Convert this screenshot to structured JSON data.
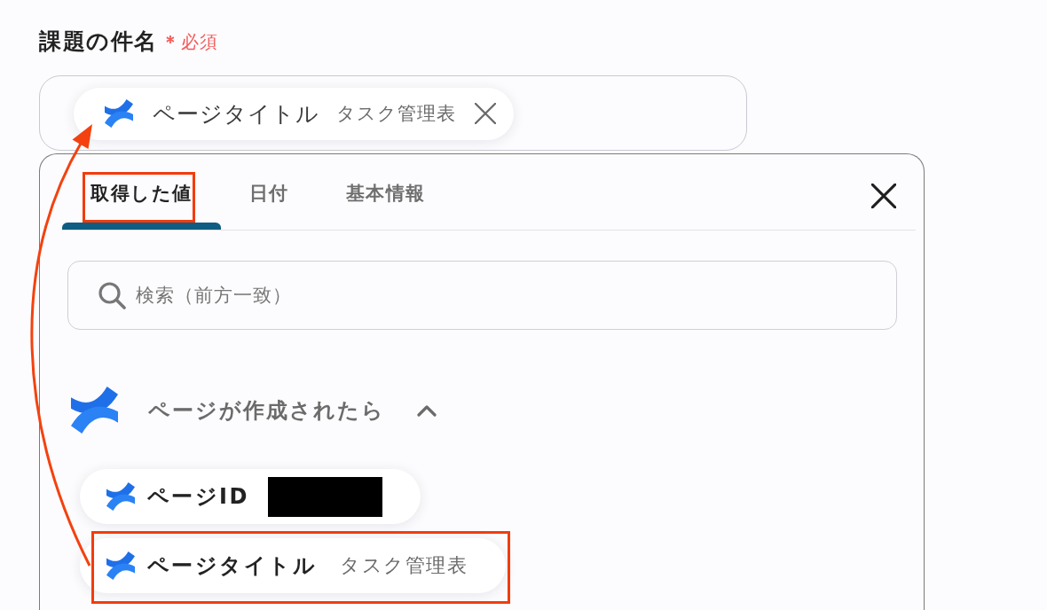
{
  "field": {
    "label": "課題の件名",
    "required_mark": "＊",
    "required_text": "必須",
    "token": {
      "label": "ページタイトル",
      "value": "タスク管理表"
    }
  },
  "picker": {
    "tabs": [
      {
        "label": "取得した値",
        "selected": true,
        "highlighted": true
      },
      {
        "label": "日付",
        "selected": false,
        "highlighted": false
      },
      {
        "label": "基本情報",
        "selected": false,
        "highlighted": false
      }
    ],
    "search": {
      "placeholder": "検索（前方一致）"
    },
    "groups": [
      {
        "title": "ページが作成されたら",
        "expanded": true,
        "items": [
          {
            "label": "ページID",
            "value_redacted": true,
            "highlighted": false
          },
          {
            "label": "ページタイトル",
            "value": "タスク管理表",
            "value_redacted": false,
            "highlighted": true
          }
        ]
      }
    ]
  },
  "annotations": {
    "callout_arrow": true
  }
}
